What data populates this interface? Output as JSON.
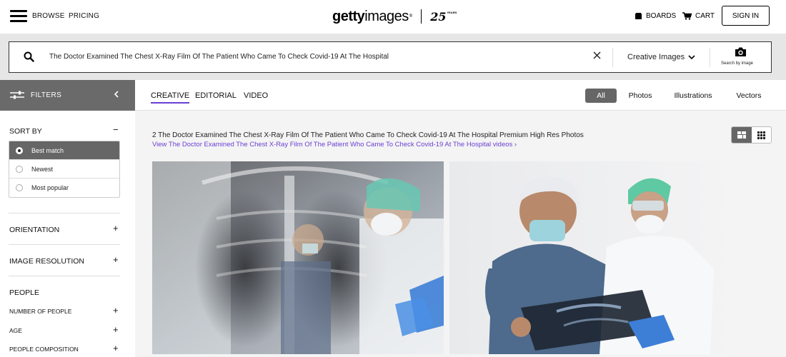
{
  "nav": {
    "browse": "BROWSE",
    "pricing": "PRICING",
    "logo_bold": "getty",
    "logo_light": "images",
    "logo_reg": "®",
    "logo_anniv": "25",
    "logo_years": "YEARS",
    "boards": "BOARDS",
    "cart": "CART",
    "signin": "SIGN IN"
  },
  "search": {
    "query": "The Doctor Examined The Chest X-Ray Film Of The Patient Who Came To Check Covid-19 At The Hospital",
    "collection": "Creative Images",
    "search_by_image": "Search by image"
  },
  "filters": {
    "label": "FILTERS",
    "sort_by": "SORT BY",
    "sort_options": [
      {
        "label": "Best match",
        "selected": true
      },
      {
        "label": "Newest",
        "selected": false
      },
      {
        "label": "Most popular",
        "selected": false
      }
    ],
    "orientation": "ORIENTATION",
    "image_resolution": "IMAGE RESOLUTION",
    "people": "PEOPLE",
    "number_of_people": "NUMBER OF PEOPLE",
    "age": "AGE",
    "people_composition": "PEOPLE COMPOSITION",
    "minus": "−",
    "plus": "+"
  },
  "tabs": {
    "creative": "CREATIVE",
    "editorial": "EDITORIAL",
    "video": "VIDEO"
  },
  "asset_types": {
    "all": "All",
    "photos": "Photos",
    "illustrations": "Illustrations",
    "vectors": "Vectors"
  },
  "results": {
    "title": "2 The Doctor Examined The Chest X-Ray Film Of The Patient Who Came To Check Covid-19 At The Hospital Premium High Res Photos",
    "videos_link": "View The Doctor Examined The Chest X-Ray Film Of The Patient Who Came To Check Covid-19 At The Hospital videos ›"
  },
  "colors": {
    "accent": "#6a3fd4",
    "filter_bar": "#6a6a6a",
    "selected_pill": "#666666",
    "search_band": "#e6e6e6"
  }
}
